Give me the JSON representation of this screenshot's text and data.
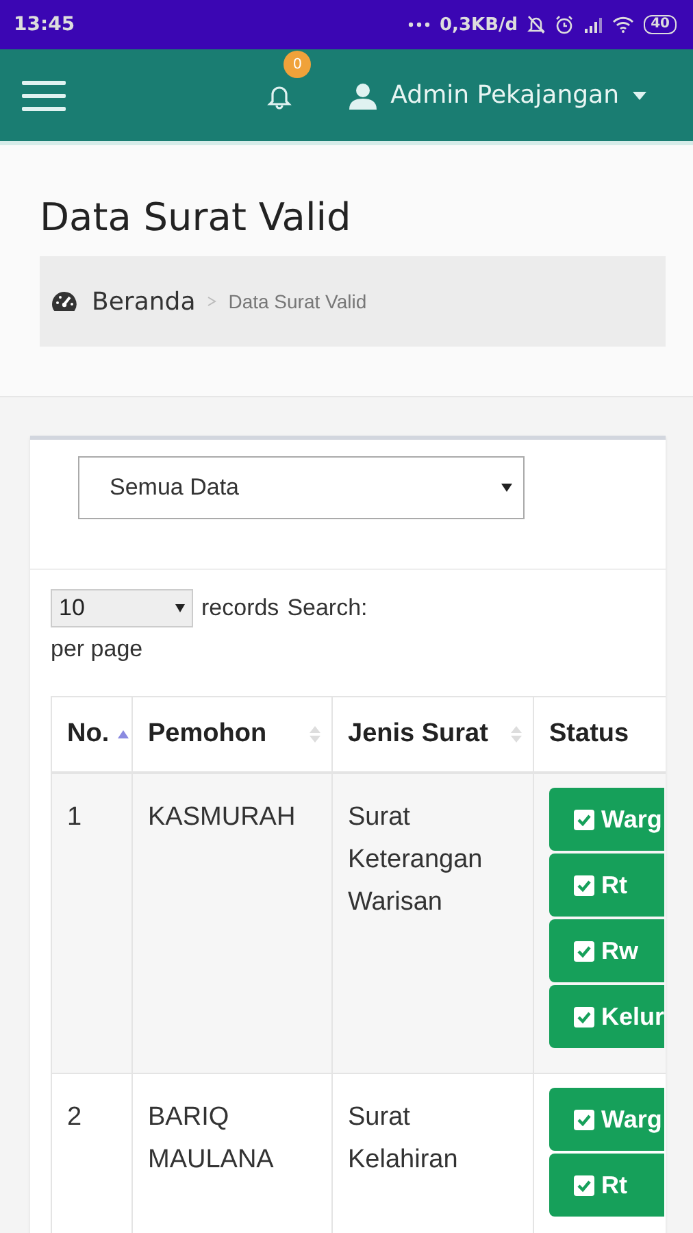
{
  "status_bar": {
    "time": "13:45",
    "speed": "0,3KB/d",
    "battery": "40"
  },
  "navbar": {
    "notification_count": "0",
    "user": "Admin Pekajangan"
  },
  "page_title": "Data Surat Valid",
  "breadcrumb": [
    {
      "label": "Beranda",
      "kind": "home"
    },
    {
      "label": "Data Surat Valid",
      "kind": "current"
    }
  ],
  "filter": {
    "value": "Semua Data"
  },
  "table_controls": {
    "page_size": "10",
    "records_label": "records",
    "per_page_label": "per page",
    "search_label": "Search:"
  },
  "table": {
    "columns": [
      {
        "label": "No.",
        "sortable": true,
        "sorted": true
      },
      {
        "label": "Pemohon",
        "sortable": true,
        "sorted": false
      },
      {
        "label": "Jenis Surat",
        "sortable": true,
        "sorted": false
      },
      {
        "label": "Status",
        "sortable": false
      }
    ],
    "rows": [
      {
        "no": "1",
        "pemohon": "KASMURAH",
        "jenis": "Surat Keterangan Warisan",
        "status": [
          {
            "label": "Warg",
            "checked": true
          },
          {
            "label": "Rt",
            "checked": true
          },
          {
            "label": "Rw",
            "checked": true
          },
          {
            "label": "Kelur",
            "checked": true
          }
        ]
      },
      {
        "no": "2",
        "pemohon": "BARIQ MAULANA",
        "jenis": "Surat Kelahiran",
        "status": [
          {
            "label": "Warg",
            "checked": true
          },
          {
            "label": "Rt",
            "checked": true
          }
        ]
      }
    ]
  }
}
